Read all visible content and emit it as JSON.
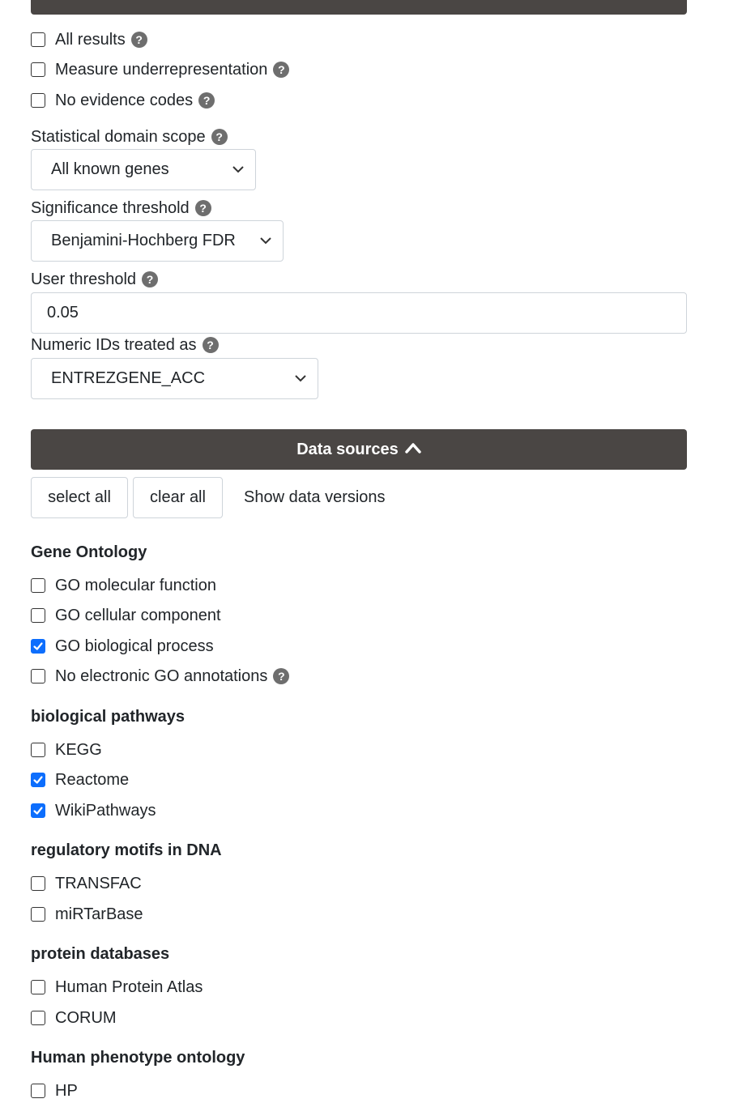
{
  "options": {
    "all_results": "All results",
    "measure_under": "Measure underrepresentation",
    "no_evidence": "No evidence codes"
  },
  "domain_scope": {
    "label": "Statistical domain scope",
    "value": "All known genes"
  },
  "sig_threshold": {
    "label": "Significance threshold",
    "value": "Benjamini-Hochberg FDR"
  },
  "user_threshold": {
    "label": "User threshold",
    "value": "0.05"
  },
  "numeric_ids": {
    "label": "Numeric IDs treated as",
    "value": "ENTREZGENE_ACC"
  },
  "data_sources": {
    "header": "Data sources",
    "select_all": "select all",
    "clear_all": "clear all",
    "show_versions": "Show data versions"
  },
  "sections": {
    "go": {
      "title": "Gene Ontology",
      "items": [
        {
          "label": "GO molecular function",
          "checked": false
        },
        {
          "label": "GO cellular component",
          "checked": false
        },
        {
          "label": "GO biological process",
          "checked": true
        },
        {
          "label": "No electronic GO annotations",
          "checked": false
        }
      ]
    },
    "pathways": {
      "title": "biological pathways",
      "items": [
        {
          "label": "KEGG",
          "checked": false
        },
        {
          "label": "Reactome",
          "checked": true
        },
        {
          "label": "WikiPathways",
          "checked": true
        }
      ]
    },
    "motifs": {
      "title": "regulatory motifs in DNA",
      "items": [
        {
          "label": "TRANSFAC",
          "checked": false
        },
        {
          "label": "miRTarBase",
          "checked": false
        }
      ]
    },
    "protein": {
      "title": "protein databases",
      "items": [
        {
          "label": "Human Protein Atlas",
          "checked": false
        },
        {
          "label": "CORUM",
          "checked": false
        }
      ]
    },
    "hp": {
      "title": "Human phenotype ontology",
      "items": [
        {
          "label": "HP",
          "checked": false
        }
      ]
    }
  },
  "colors": {
    "accent": "#0d6efd",
    "bar": "#4a4644",
    "help": "#6e6e6e"
  }
}
